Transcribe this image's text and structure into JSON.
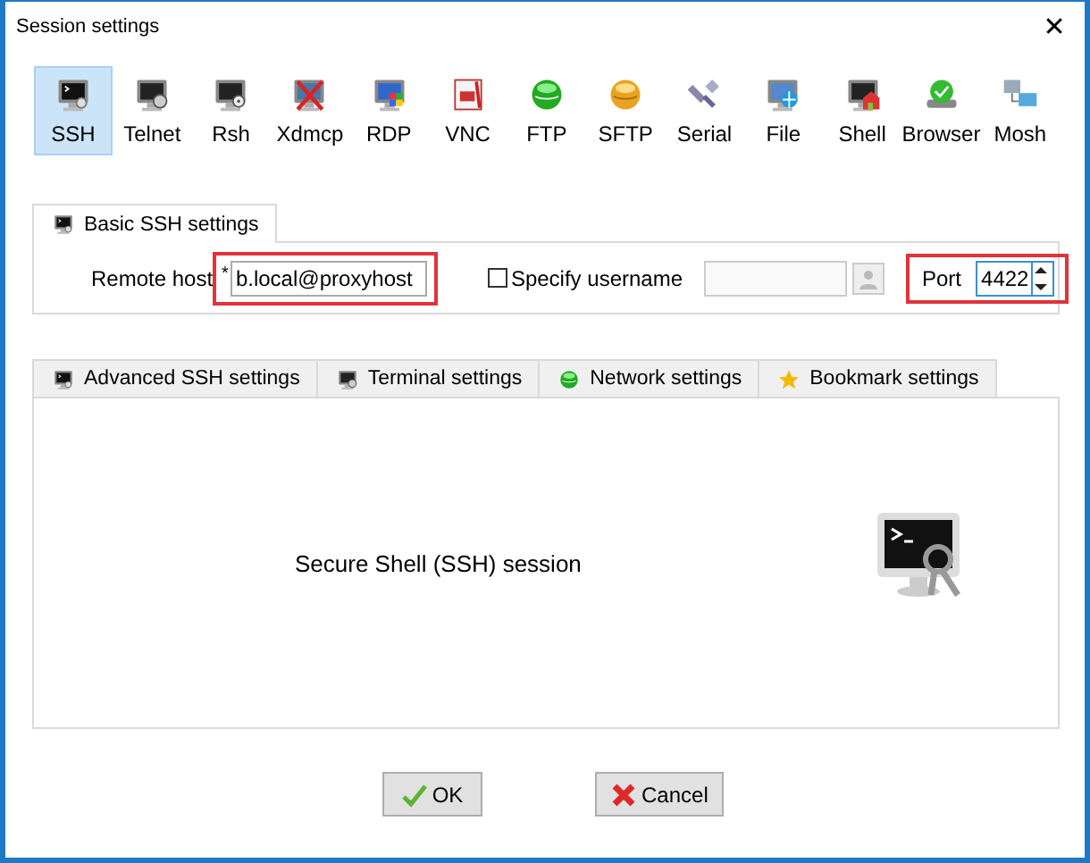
{
  "window": {
    "title": "Session settings",
    "close": "✕"
  },
  "session_types": [
    {
      "label": "SSH",
      "selected": true
    },
    {
      "label": "Telnet",
      "selected": false
    },
    {
      "label": "Rsh",
      "selected": false
    },
    {
      "label": "Xdmcp",
      "selected": false
    },
    {
      "label": "RDP",
      "selected": false
    },
    {
      "label": "VNC",
      "selected": false
    },
    {
      "label": "FTP",
      "selected": false
    },
    {
      "label": "SFTP",
      "selected": false
    },
    {
      "label": "Serial",
      "selected": false
    },
    {
      "label": "File",
      "selected": false
    },
    {
      "label": "Shell",
      "selected": false
    },
    {
      "label": "Browser",
      "selected": false
    },
    {
      "label": "Mosh",
      "selected": false
    }
  ],
  "basic_tab": {
    "label": "Basic SSH settings",
    "selected": true
  },
  "remote_host": {
    "label": "Remote host",
    "required_mark": "*",
    "value": "b.local@proxyhost",
    "highlighted": true
  },
  "specify_username": {
    "label": "Specify username",
    "checked": false
  },
  "port": {
    "label": "Port",
    "value": "4422",
    "highlighted": true
  },
  "option_tabs": [
    {
      "label": "Advanced SSH settings",
      "selected": false
    },
    {
      "label": "Terminal settings",
      "selected": false
    },
    {
      "label": "Network settings",
      "selected": false
    },
    {
      "label": "Bookmark settings",
      "selected": false
    }
  ],
  "session_description": "Secure Shell (SSH) session",
  "buttons": [
    {
      "label": "OK",
      "kind": "ok"
    },
    {
      "label": "Cancel",
      "kind": "cancel"
    }
  ]
}
